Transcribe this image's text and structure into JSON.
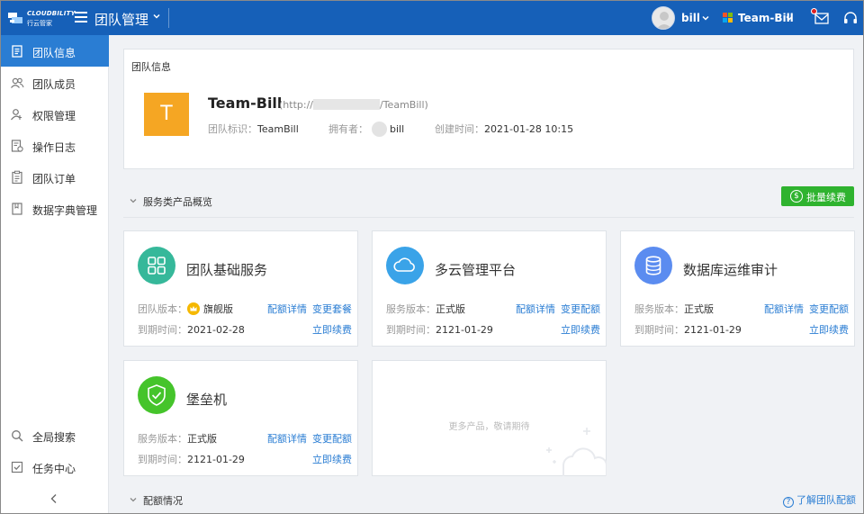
{
  "topbar": {
    "logo_text": "CLOUDBILITY",
    "logo_sub": "行云管家",
    "module_title": "团队管理",
    "user_name": "bill",
    "team_name": "Team-Bill"
  },
  "sidebar": {
    "items": [
      {
        "label": "团队信息",
        "icon": "document-icon",
        "active": true
      },
      {
        "label": "团队成员",
        "icon": "users-icon",
        "active": false
      },
      {
        "label": "权限管理",
        "icon": "user-key-icon",
        "active": false
      },
      {
        "label": "操作日志",
        "icon": "log-icon",
        "active": false
      },
      {
        "label": "团队订单",
        "icon": "clipboard-icon",
        "active": false
      },
      {
        "label": "数据字典管理",
        "icon": "book-icon",
        "active": false
      }
    ],
    "bottom_items": [
      {
        "label": "全局搜索",
        "icon": "search-icon"
      },
      {
        "label": "任务中心",
        "icon": "task-icon"
      }
    ]
  },
  "team_info": {
    "caption": "团队信息",
    "avatar_letter": "T",
    "name": "Team-Bill",
    "url_prefix": "(http://",
    "url_suffix": "/TeamBill)",
    "id_label": "团队标识：",
    "id_value": "TeamBill",
    "owner_label": "拥有者：",
    "owner_value": "bill",
    "created_label": "创建时间：",
    "created_value": "2021-01-28 10:15"
  },
  "services": {
    "section_title": "服务类产品概览",
    "renew_all_label": "批量续费",
    "cards": [
      {
        "name": "团队基础服务",
        "version_label": "团队版本：",
        "version": "旗舰版",
        "expire_label": "到期时间：",
        "expire": "2021-02-28",
        "link_quota": "配额详情",
        "link_change": "变更套餐",
        "link_renew": "立即续费",
        "color": "#36b89a"
      },
      {
        "name": "多云管理平台",
        "version_label": "服务版本：",
        "version": "正式版",
        "expire_label": "到期时间：",
        "expire": "2121-01-29",
        "link_quota": "配额详情",
        "link_change": "变更配额",
        "link_renew": "立即续费",
        "color": "#3aa3e8"
      },
      {
        "name": "数据库运维审计",
        "version_label": "服务版本：",
        "version": "正式版",
        "expire_label": "到期时间：",
        "expire": "2121-01-29",
        "link_quota": "配额详情",
        "link_change": "变更配额",
        "link_renew": "立即续费",
        "color": "#5b8cf0"
      },
      {
        "name": "堡垒机",
        "version_label": "服务版本：",
        "version": "正式版",
        "expire_label": "到期时间：",
        "expire": "2121-01-29",
        "link_quota": "配额详情",
        "link_change": "变更配额",
        "link_renew": "立即续费",
        "color": "#45c42b"
      }
    ],
    "more_text": "更多产品，敬请期待"
  },
  "quota": {
    "section_title": "配额情况",
    "help_link": "了解团队配额"
  }
}
